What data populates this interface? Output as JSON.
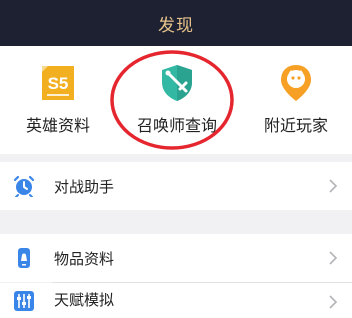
{
  "header": {
    "title": "发现"
  },
  "quick": {
    "items": [
      {
        "label": "英雄资料",
        "icon": "s5-badge-icon",
        "badge": "S5",
        "color": "#f2b021"
      },
      {
        "label": "召唤师查询",
        "icon": "shield-sword-icon",
        "color": "#33b8a4"
      },
      {
        "label": "附近玩家",
        "icon": "location-pin-icon",
        "color": "#f6a026"
      }
    ]
  },
  "menu": {
    "items": [
      {
        "label": "对战助手",
        "icon": "alarm-clock-icon",
        "color": "#3a86e8"
      },
      {
        "label": "物品资料",
        "icon": "phone-bag-icon",
        "color": "#3a86e8"
      },
      {
        "label": "天赋模拟",
        "icon": "sliders-icon",
        "color": "#3a86e8"
      }
    ]
  },
  "colors": {
    "header_bg": "#1d2131",
    "header_text": "#e9c58b",
    "highlight_ring": "#e5262e"
  }
}
